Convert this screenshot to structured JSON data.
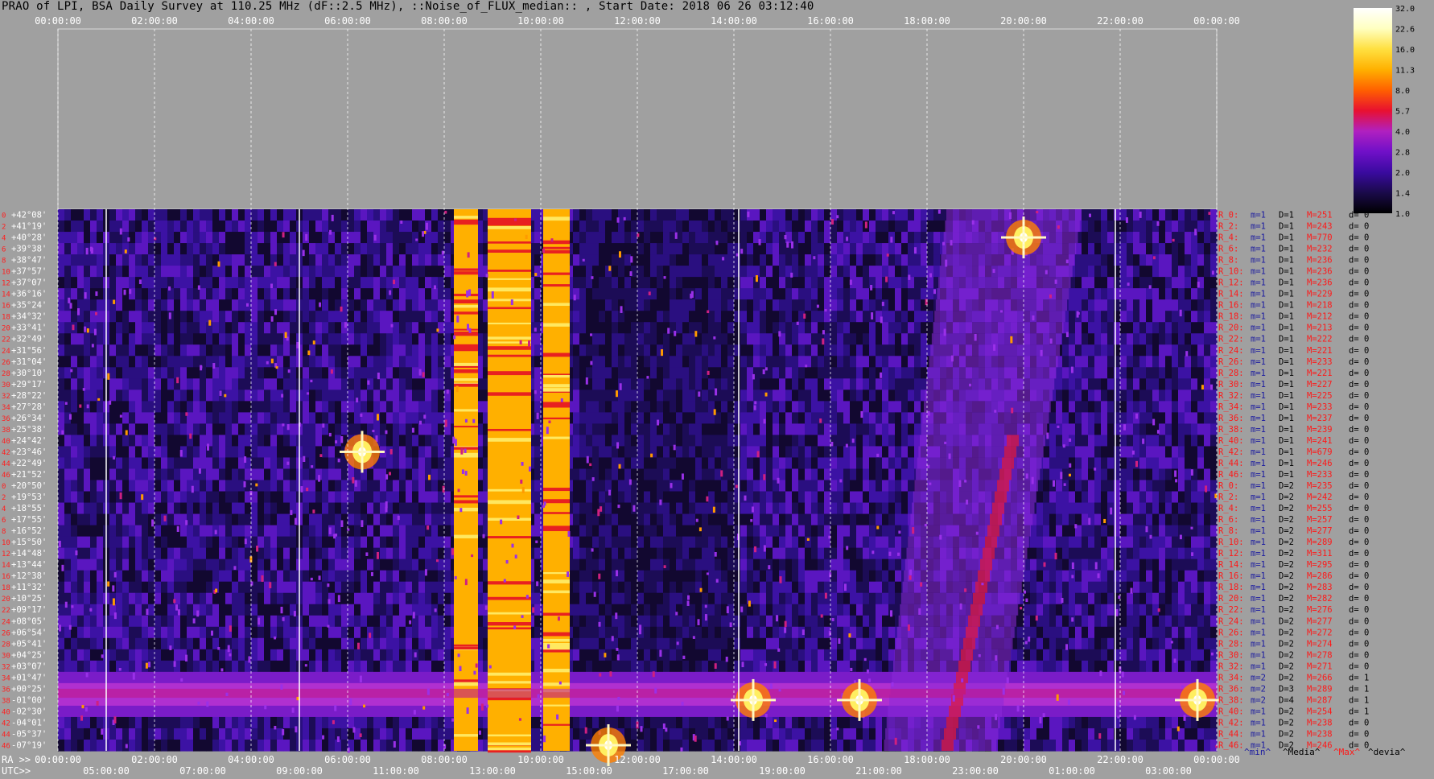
{
  "title": "PRAO of LPI, BSA Daily Survey at 110.25 MHz (dF::2.5 MHz), ::Noise_of_FLUX_median:: , Start Date: 2018 06 26 03:12:40",
  "chart_data": {
    "type": "heatmap",
    "title": "PRAO of LPI, BSA Daily Survey at 110.25 MHz (dF::2.5 MHz), ::Noise_of_FLUX_median:: , Start Date: 2018 06 26 03:12:40",
    "x_top_ticks": [
      "00:00:00",
      "02:00:00",
      "04:00:00",
      "06:00:00",
      "08:00:00",
      "10:00:00",
      "12:00:00",
      "14:00:00",
      "16:00:00",
      "18:00:00",
      "20:00:00",
      "22:00:00",
      "00:00:00"
    ],
    "x_ra_ticks": [
      "00:00:00",
      "02:00:00",
      "04:00:00",
      "06:00:00",
      "08:00:00",
      "10:00:00",
      "12:00:00",
      "14:00:00",
      "16:00:00",
      "18:00:00",
      "20:00:00",
      "22:00:00",
      "00:00:00"
    ],
    "x_utc_ticks": [
      "05:00:00",
      "07:00:00",
      "09:00:00",
      "11:00:00",
      "13:00:00",
      "15:00:00",
      "17:00:00",
      "19:00:00",
      "21:00:00",
      "23:00:00",
      "01:00:00",
      "03:00:00"
    ],
    "ra_prefix": "RA >>",
    "utc_prefix": "UTC>>",
    "declinations": [
      "+42°08'",
      "+41°19'",
      "+40°28'",
      "+39°38'",
      "+38°47'",
      "+37°57'",
      "+37°07'",
      "+36°16'",
      "+35°24'",
      "+34°32'",
      "+33°41'",
      "+32°49'",
      "+31°56'",
      "+31°04'",
      "+30°10'",
      "+29°17'",
      "+28°22'",
      "+27°28'",
      "+26°34'",
      "+25°38'",
      "+24°42'",
      "+23°46'",
      "+22°49'",
      "+21°52'",
      "+20°50'",
      "+19°53'",
      "+18°55'",
      "+17°55'",
      "+16°52'",
      "+15°50'",
      "+14°48'",
      "+13°44'",
      "+12°38'",
      "+11°32'",
      "+10°25'",
      "+09°17'",
      "+08°05'",
      "+06°54'",
      "+05°41'",
      "+04°25'",
      "+03°07'",
      "+01°47'",
      "+00°25'",
      "-01°00'",
      "-02°30'",
      "-04°01'",
      "-05°37'",
      "-07°19'"
    ],
    "row_numbers": [
      "0",
      "2",
      "4",
      "6",
      "8",
      "10",
      "12",
      "14",
      "16",
      "18",
      "20",
      "22",
      "24",
      "26",
      "28",
      "30",
      "32",
      "34",
      "36",
      "38",
      "40",
      "42",
      "44",
      "46",
      "0",
      "2",
      "4",
      "6",
      "8",
      "10",
      "12",
      "14",
      "16",
      "18",
      "20",
      "22",
      "24",
      "26",
      "28",
      "30",
      "32",
      "34",
      "36",
      "38",
      "40",
      "42",
      "44",
      "46"
    ],
    "rows": [
      {
        "r": "R_0:",
        "m": "m=1",
        "D": "D=1",
        "M": "M=251",
        "d": "d= 0"
      },
      {
        "r": "R_2:",
        "m": "m=1",
        "D": "D=1",
        "M": "M=243",
        "d": "d= 0"
      },
      {
        "r": "R_4:",
        "m": "m=1",
        "D": "D=1",
        "M": "M=770",
        "d": "d= 0"
      },
      {
        "r": "R_6:",
        "m": "m=1",
        "D": "D=1",
        "M": "M=232",
        "d": "d= 0"
      },
      {
        "r": "R_8:",
        "m": "m=1",
        "D": "D=1",
        "M": "M=236",
        "d": "d= 0"
      },
      {
        "r": "R_10:",
        "m": "m=1",
        "D": "D=1",
        "M": "M=236",
        "d": "d= 0"
      },
      {
        "r": "R_12:",
        "m": "m=1",
        "D": "D=1",
        "M": "M=236",
        "d": "d= 0"
      },
      {
        "r": "R_14:",
        "m": "m=1",
        "D": "D=1",
        "M": "M=229",
        "d": "d= 0"
      },
      {
        "r": "R_16:",
        "m": "m=1",
        "D": "D=1",
        "M": "M=218",
        "d": "d= 0"
      },
      {
        "r": "R_18:",
        "m": "m=1",
        "D": "D=1",
        "M": "M=212",
        "d": "d= 0"
      },
      {
        "r": "R_20:",
        "m": "m=1",
        "D": "D=1",
        "M": "M=213",
        "d": "d= 0"
      },
      {
        "r": "R_22:",
        "m": "m=1",
        "D": "D=1",
        "M": "M=222",
        "d": "d= 0"
      },
      {
        "r": "R_24:",
        "m": "m=1",
        "D": "D=1",
        "M": "M=221",
        "d": "d= 0"
      },
      {
        "r": "R_26:",
        "m": "m=1",
        "D": "D=1",
        "M": "M=233",
        "d": "d= 0"
      },
      {
        "r": "R_28:",
        "m": "m=1",
        "D": "D=1",
        "M": "M=221",
        "d": "d= 0"
      },
      {
        "r": "R_30:",
        "m": "m=1",
        "D": "D=1",
        "M": "M=227",
        "d": "d= 0"
      },
      {
        "r": "R_32:",
        "m": "m=1",
        "D": "D=1",
        "M": "M=225",
        "d": "d= 0"
      },
      {
        "r": "R_34:",
        "m": "m=1",
        "D": "D=1",
        "M": "M=233",
        "d": "d= 0"
      },
      {
        "r": "R_36:",
        "m": "m=1",
        "D": "D=1",
        "M": "M=237",
        "d": "d= 0"
      },
      {
        "r": "R_38:",
        "m": "m=1",
        "D": "D=1",
        "M": "M=239",
        "d": "d= 0"
      },
      {
        "r": "R_40:",
        "m": "m=1",
        "D": "D=1",
        "M": "M=241",
        "d": "d= 0"
      },
      {
        "r": "R_42:",
        "m": "m=1",
        "D": "D=1",
        "M": "M=679",
        "d": "d= 0"
      },
      {
        "r": "R_44:",
        "m": "m=1",
        "D": "D=1",
        "M": "M=246",
        "d": "d= 0"
      },
      {
        "r": "R_46:",
        "m": "m=1",
        "D": "D=1",
        "M": "M=233",
        "d": "d= 0"
      },
      {
        "r": "R_0:",
        "m": "m=1",
        "D": "D=2",
        "M": "M=235",
        "d": "d= 0"
      },
      {
        "r": "R_2:",
        "m": "m=1",
        "D": "D=2",
        "M": "M=242",
        "d": "d= 0"
      },
      {
        "r": "R_4:",
        "m": "m=1",
        "D": "D=2",
        "M": "M=255",
        "d": "d= 0"
      },
      {
        "r": "R_6:",
        "m": "m=1",
        "D": "D=2",
        "M": "M=257",
        "d": "d= 0"
      },
      {
        "r": "R_8:",
        "m": "m=1",
        "D": "D=2",
        "M": "M=277",
        "d": "d= 0"
      },
      {
        "r": "R_10:",
        "m": "m=1",
        "D": "D=2",
        "M": "M=289",
        "d": "d= 0"
      },
      {
        "r": "R_12:",
        "m": "m=1",
        "D": "D=2",
        "M": "M=311",
        "d": "d= 0"
      },
      {
        "r": "R_14:",
        "m": "m=1",
        "D": "D=2",
        "M": "M=295",
        "d": "d= 0"
      },
      {
        "r": "R_16:",
        "m": "m=1",
        "D": "D=2",
        "M": "M=286",
        "d": "d= 0"
      },
      {
        "r": "R_18:",
        "m": "m=1",
        "D": "D=2",
        "M": "M=283",
        "d": "d= 0"
      },
      {
        "r": "R_20:",
        "m": "m=1",
        "D": "D=2",
        "M": "M=282",
        "d": "d= 0"
      },
      {
        "r": "R_22:",
        "m": "m=1",
        "D": "D=2",
        "M": "M=276",
        "d": "d= 0"
      },
      {
        "r": "R_24:",
        "m": "m=1",
        "D": "D=2",
        "M": "M=277",
        "d": "d= 0"
      },
      {
        "r": "R_26:",
        "m": "m=1",
        "D": "D=2",
        "M": "M=272",
        "d": "d= 0"
      },
      {
        "r": "R_28:",
        "m": "m=1",
        "D": "D=2",
        "M": "M=274",
        "d": "d= 0"
      },
      {
        "r": "R_30:",
        "m": "m=1",
        "D": "D=2",
        "M": "M=278",
        "d": "d= 0"
      },
      {
        "r": "R_32:",
        "m": "m=1",
        "D": "D=2",
        "M": "M=271",
        "d": "d= 0"
      },
      {
        "r": "R_34:",
        "m": "m=2",
        "D": "D=2",
        "M": "M=266",
        "d": "d= 1"
      },
      {
        "r": "R_36:",
        "m": "m=2",
        "D": "D=3",
        "M": "M=289",
        "d": "d= 1"
      },
      {
        "r": "R_38:",
        "m": "m=2",
        "D": "D=4",
        "M": "M=287",
        "d": "d= 1"
      },
      {
        "r": "R_40:",
        "m": "m=1",
        "D": "D=2",
        "M": "M=254",
        "d": "d= 1"
      },
      {
        "r": "R_42:",
        "m": "m=1",
        "D": "D=2",
        "M": "M=238",
        "d": "d= 0"
      },
      {
        "r": "R_44:",
        "m": "m=1",
        "D": "D=2",
        "M": "M=238",
        "d": "d= 0"
      },
      {
        "r": "R_46:",
        "m": "m=1",
        "D": "D=2",
        "M": "M=246",
        "d": "d= 0"
      }
    ],
    "footer": {
      "min": "^min^",
      "media": "^Media^",
      "max": "^Max^",
      "devia": "^devia^"
    },
    "colorbar_ticks": [
      "32.0",
      "22.6",
      "16.0",
      "11.3",
      "8.0",
      "5.7",
      "4.0",
      "2.8",
      "2.0",
      "1.4",
      "1.0"
    ],
    "colorbar_colors": [
      "#000000",
      "#1a0a4a",
      "#3a0aa0",
      "#7010c8",
      "#b020c0",
      "#e81030",
      "#ff6000",
      "#ffb000",
      "#ffe040",
      "#ffffc0",
      "#ffffff"
    ],
    "features": {
      "bright_bands_ra_hours": [
        [
          8.2,
          8.7
        ],
        [
          8.9,
          9.8
        ],
        [
          10.05,
          10.6
        ]
      ],
      "bright_spots": [
        {
          "ra_hours": 6.3,
          "dec_index": 21
        },
        {
          "ra_hours": 20.0,
          "dec_index": 2
        },
        {
          "ra_hours": 11.4,
          "dec_index": 47
        },
        {
          "ra_hours": 14.4,
          "dec_index": 43
        },
        {
          "ra_hours": 16.6,
          "dec_index": 43
        },
        {
          "ra_hours": 23.6,
          "dec_index": 43
        }
      ]
    }
  }
}
